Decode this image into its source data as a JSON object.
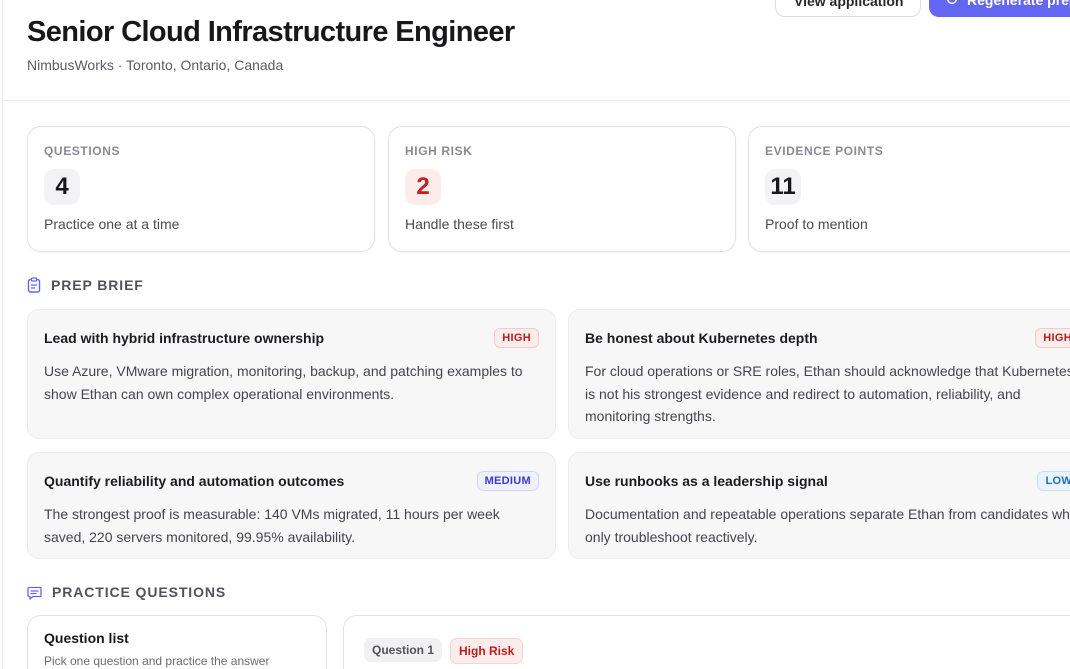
{
  "job": {
    "title": "Senior Cloud Infrastructure Engineer",
    "subtitle": "NimbusWorks · Toronto, Ontario, Canada"
  },
  "actions": {
    "view_label": "View application",
    "regenerate_label": "Regenerate prep"
  },
  "stats": [
    {
      "label": "QUESTIONS",
      "value": "4",
      "hint": "Practice one at a time"
    },
    {
      "label": "HIGH RISK",
      "value": "2",
      "hint": "Handle these first"
    },
    {
      "label": "EVIDENCE POINTS",
      "value": "11",
      "hint": "Proof to mention"
    }
  ],
  "prep_brief": {
    "title": "PREP BRIEF",
    "icon": "clipboard-icon",
    "cards": [
      {
        "title": "Lead with hybrid infrastructure ownership",
        "badge": "HIGH",
        "body": "Use Azure, VMware migration, monitoring, backup, and patching examples to show Ethan can own complex operational environments."
      },
      {
        "title": "Be honest about Kubernetes depth",
        "badge": "HIGH",
        "body": "For cloud operations or SRE roles, Ethan should acknowledge that Kubernetes is not his strongest evidence and redirect to automation, reliability, and monitoring strengths."
      },
      {
        "title": "Quantify reliability and automation outcomes",
        "badge": "MEDIUM",
        "body": "The strongest proof is measurable: 140 VMs migrated, 11 hours per week saved, 220 servers monitored, 99.95% availability."
      },
      {
        "title": "Use runbooks as a leadership signal",
        "badge": "LOW",
        "body": "Documentation and repeatable operations separate Ethan from candidates who only troubleshoot reactively."
      }
    ]
  },
  "practice": {
    "title": "PRACTICE QUESTIONS",
    "icon": "message-icon",
    "list_title": "Question list",
    "list_hint": "Pick one question and practice the answer",
    "current_question": "Question 1",
    "current_risk": "High Risk"
  },
  "colors": {
    "accent": "#6366f1",
    "high": "#c81e1e",
    "medium": "#4338ca",
    "low": "#1d6fb8"
  }
}
